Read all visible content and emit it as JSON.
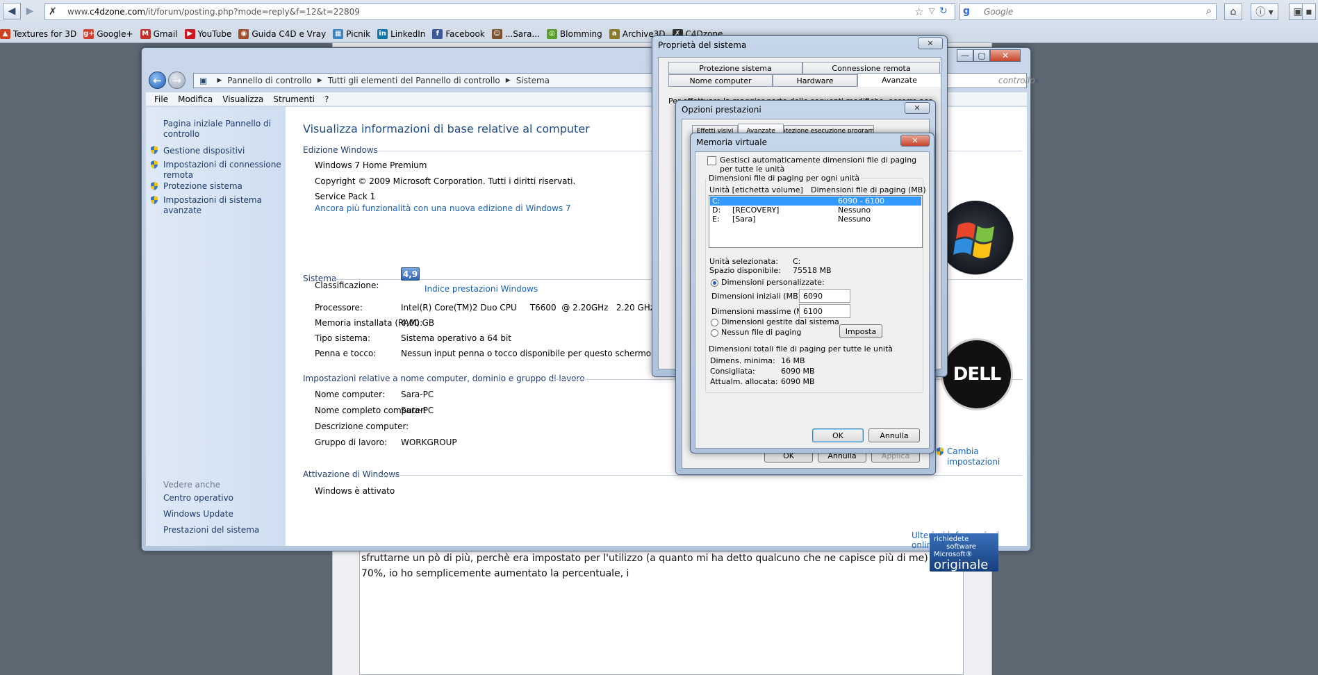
{
  "browser": {
    "url_prefix": "www.",
    "url_domain": "c4dzone.com",
    "url_path": "/it/forum/posting.php?mode=reply&f=12&t=22809",
    "search_placeholder": "Google",
    "search_engine_letter": "g",
    "bookmarks": [
      {
        "label": "Textures for 3D",
        "color": "#d04020"
      },
      {
        "label": "Google+",
        "color": "#d23f31"
      },
      {
        "label": "Gmail",
        "color": "#c4302b"
      },
      {
        "label": "YouTube",
        "color": "#cc181e"
      },
      {
        "label": "Guida C4D e Vray",
        "color": "#a0502a"
      },
      {
        "label": "Picnik",
        "color": "#3b84c4"
      },
      {
        "label": "LinkedIn",
        "color": "#0e76a8"
      },
      {
        "label": "Facebook",
        "color": "#3b5998"
      },
      {
        "label": "...Sara...",
        "color": "#7a5230"
      },
      {
        "label": "Blomming",
        "color": "#5aa02c"
      },
      {
        "label": "Archive3D",
        "color": "#8c7a2a"
      },
      {
        "label": "C4Dzone",
        "color": "#333333"
      }
    ]
  },
  "forum": {
    "text": "sfruttarne un pò di più, perchè era impostato per l'utilizzo (a quanto mi ha detto qualcuno che ne capisce più di me) al 70%, io ho semplicemente aumentato la percentuale, i"
  },
  "control_panel": {
    "breadcrumb": [
      "Pannello di controllo",
      "Tutti gli elementi del Pannello di controllo",
      "Sistema"
    ],
    "search_placeholder": "controllo",
    "menu": [
      "File",
      "Modifica",
      "Visualizza",
      "Strumenti",
      "?"
    ],
    "sidebar": {
      "home": "Pagina iniziale Pannello di controllo",
      "links": [
        "Gestione dispositivi",
        "Impostazioni di connessione remota",
        "Protezione sistema",
        "Impostazioni di sistema avanzate"
      ],
      "see_also_title": "Vedere anche",
      "see_also": [
        "Centro operativo",
        "Windows Update",
        "Prestazioni del sistema"
      ]
    },
    "title": "Visualizza informazioni di base relative al computer",
    "edition": {
      "header": "Edizione Windows",
      "name": "Windows 7 Home Premium",
      "copyright": "Copyright © 2009 Microsoft Corporation. Tutti i diritti riservati.",
      "sp": "Service Pack 1",
      "more_link": "Ancora più funzionalità con una nuova edizione di Windows 7"
    },
    "system": {
      "header": "Sistema",
      "rating_label": "Classificazione:",
      "rating_value": "4,9",
      "rating_link": "Indice prestazioni Windows",
      "rows": [
        {
          "label": "Processore:",
          "value": "Intel(R) Core(TM)2 Duo CPU     T6600  @ 2.20GHz   2.20 GHz"
        },
        {
          "label": "Memoria installata (RAM):",
          "value": "4,00 GB"
        },
        {
          "label": "Tipo sistema:",
          "value": "Sistema operativo a 64 bit"
        },
        {
          "label": "Penna e tocco:",
          "value": "Nessun input penna o tocco disponibile per questo schermo"
        }
      ]
    },
    "computer": {
      "header": "Impostazioni relative a nome computer, dominio e gruppo di lavoro",
      "rows": [
        {
          "label": "Nome computer:",
          "value": "Sara-PC"
        },
        {
          "label": "Nome completo computer:",
          "value": "Sara-PC"
        },
        {
          "label": "Descrizione computer:",
          "value": ""
        },
        {
          "label": "Gruppo di lavoro:",
          "value": "WORKGROUP"
        }
      ],
      "change_link": "Cambia impostazioni"
    },
    "activation": {
      "header": "Attivazione di Windows",
      "status": "Windows è attivato",
      "more_link": "Ulteriori informazioni online..."
    },
    "genuine": {
      "line1": "richiedete",
      "line2": "software",
      "line3": "Microsoft®",
      "line4": "originale"
    },
    "dell_logo": "DELL"
  },
  "sys_props": {
    "title": "Proprietà del sistema",
    "tabs_row1": [
      "Protezione sistema",
      "Connessione remota"
    ],
    "tabs_row2": [
      "Nome computer",
      "Hardware",
      "Avanzate"
    ],
    "text": "Per effettuare la maggior parte delle seguenti modifiche, occorre accedere"
  },
  "perf_opts": {
    "title": "Opzioni prestazioni",
    "tabs": [
      "Effetti visivi",
      "Avanzate",
      "Protezione esecuzione programmi"
    ],
    "buttons": [
      "OK",
      "Annulla",
      "Applica"
    ]
  },
  "virtual_memory": {
    "title": "Memoria virtuale",
    "auto_label": "Gestisci automaticamente dimensioni file di paging per tutte le unità",
    "group1_title": "Dimensioni file di paging per ogni unità",
    "col1": "Unità [etichetta volume]",
    "col2": "Dimensioni file di paging (MB)",
    "drives": [
      {
        "drive": "C:",
        "label": "",
        "size": "6090 - 6100"
      },
      {
        "drive": "D:",
        "label": "[RECOVERY]",
        "size": "Nessuno"
      },
      {
        "drive": "E:",
        "label": "[Sara]",
        "size": "Nessuno"
      }
    ],
    "selected_label": "Unità selezionata:",
    "selected_value": "C:",
    "free_label": "Spazio disponibile:",
    "free_value": "75518 MB",
    "custom_label": "Dimensioni personalizzate:",
    "initial_label": "Dimensioni iniziali (MB):",
    "initial_value": "6090",
    "max_label": "Dimensioni massime (MB):",
    "max_value": "6100",
    "system_managed": "Dimensioni gestite dal sistema",
    "no_paging": "Nessun file di paging",
    "set_button": "Imposta",
    "group2_title": "Dimensioni totali file di paging per tutte le unità",
    "totals": [
      {
        "label": "Dimens. minima:",
        "value": "16 MB"
      },
      {
        "label": "Consigliata:",
        "value": "6090 MB"
      },
      {
        "label": "Attualm. allocata:",
        "value": "6090 MB"
      }
    ],
    "ok": "OK",
    "cancel": "Annulla"
  }
}
